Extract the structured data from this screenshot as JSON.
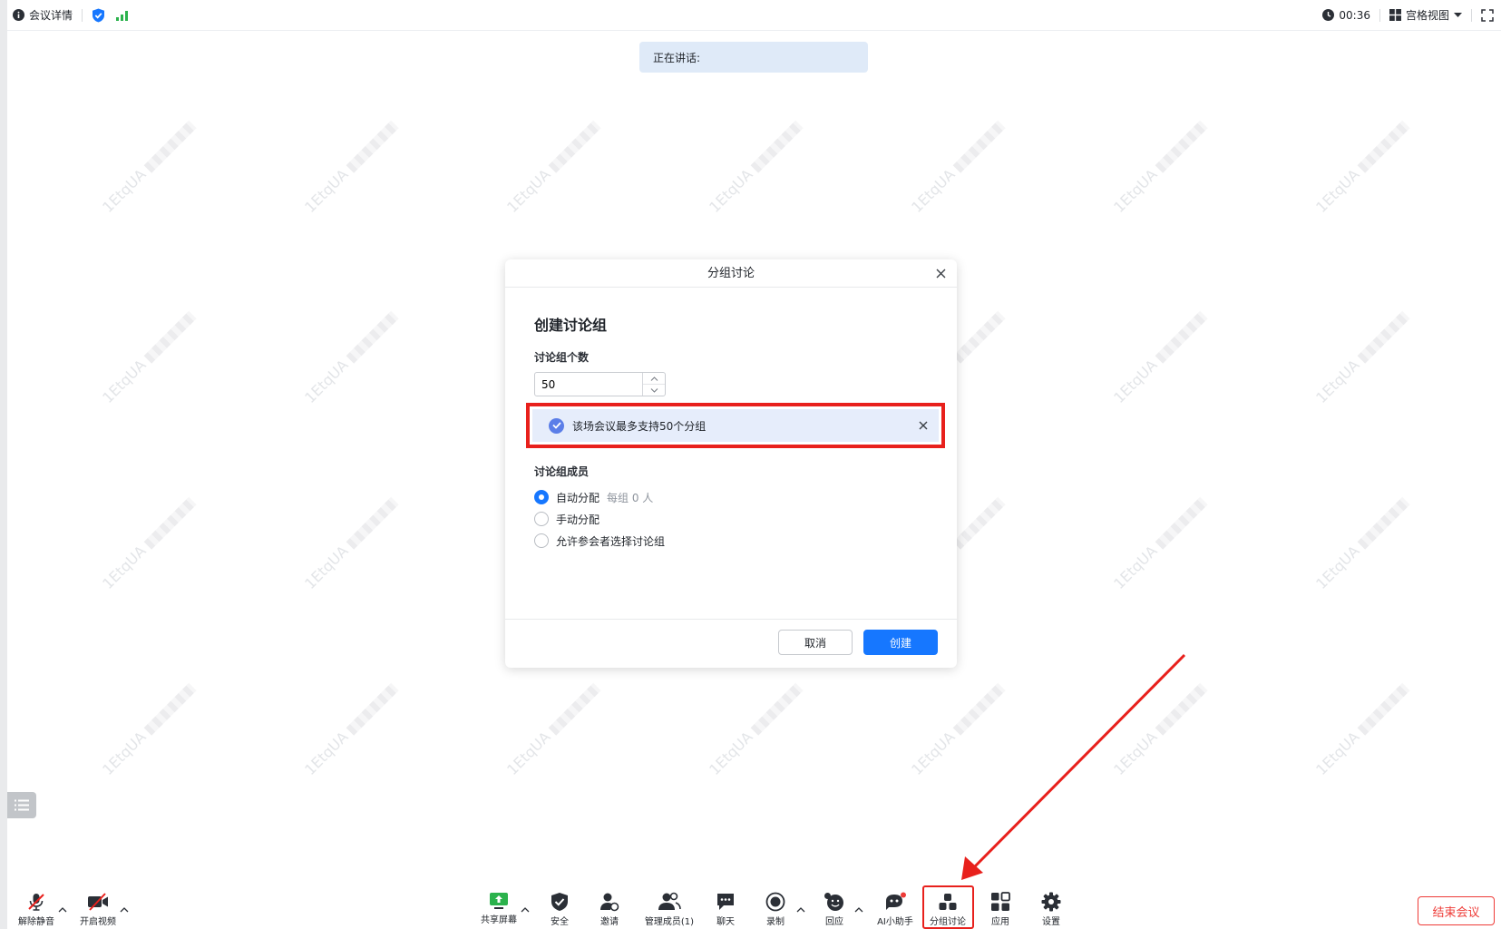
{
  "topbar": {
    "meeting_info": "会议详情",
    "timer": "00:36",
    "view_mode": "宫格视图"
  },
  "speaking": {
    "label": "正在讲话:"
  },
  "watermark": {
    "text": "1EtqUA"
  },
  "dialog": {
    "header_title": "分组讨论",
    "title": "创建讨论组",
    "group_count_label": "讨论组个数",
    "group_count_value": "50",
    "notice": "该场会议最多支持50个分组",
    "members_label": "讨论组成员",
    "options": [
      {
        "label": "自动分配",
        "hint": "每组 0 人",
        "selected": true
      },
      {
        "label": "手动分配",
        "hint": "",
        "selected": false
      },
      {
        "label": "允许参会者选择讨论组",
        "hint": "",
        "selected": false
      }
    ],
    "cancel_label": "取消",
    "create_label": "创建"
  },
  "toolbar": {
    "unmute": "解除静音",
    "video": "开启视频",
    "share": "共享屏幕",
    "security": "安全",
    "invite": "邀请",
    "members": "管理成员(1)",
    "chat": "聊天",
    "record": "录制",
    "reaction": "回应",
    "ai": "AI小助手",
    "breakout": "分组讨论",
    "apps": "应用",
    "settings": "设置",
    "end_meeting": "结束会议"
  },
  "colors": {
    "accent": "#1677ff",
    "highlight_red": "#e8201c",
    "notice_bg": "#e6edfb",
    "speaking_bg": "#dfeaf8",
    "end_red": "#ee3b37"
  },
  "icons": [
    "info-icon",
    "shield-icon",
    "signal-icon",
    "clock-icon",
    "grid-view-icon",
    "fullscreen-icon",
    "close-icon",
    "check-circle-icon",
    "list-icon",
    "mic-off-icon",
    "video-off-icon",
    "share-screen-icon",
    "security-shield-icon",
    "invite-icon",
    "members-icon",
    "chat-icon",
    "record-icon",
    "reaction-icon",
    "ai-assistant-icon",
    "breakout-icon",
    "apps-icon",
    "settings-gear-icon"
  ]
}
